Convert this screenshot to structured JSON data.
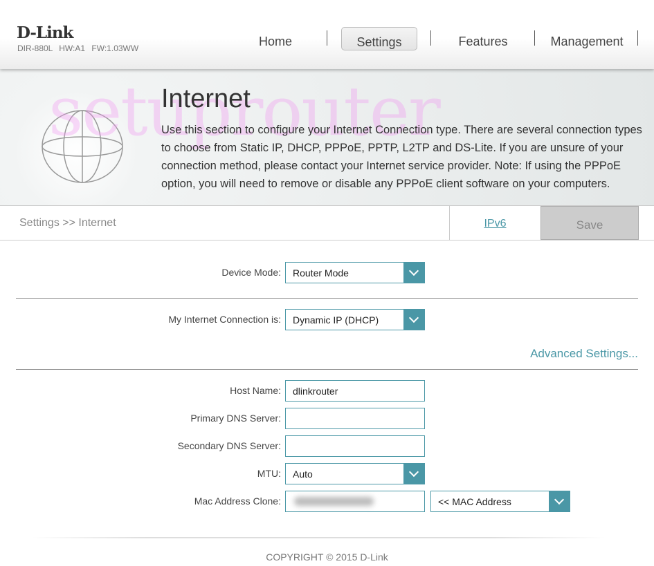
{
  "header": {
    "logo": "D-Link",
    "model": "DIR-880L",
    "hw": "HW:A1",
    "fw": "FW:1.03WW",
    "nav": [
      "Home",
      "Settings",
      "Features",
      "Management"
    ],
    "active": "Settings"
  },
  "banner": {
    "watermark": "setuprouter",
    "title": "Internet",
    "description": "Use this section to configure your Internet Connection type. There are several connection types to choose from Static IP, DHCP, PPPoE, PPTP, L2TP and DS-Lite. If you are unsure of your connection method, please contact your Internet service provider. Note: If using the PPPoE option, you will need to remove or disable any PPPoE client software on your computers."
  },
  "breadcrumb": "Settings >> Internet",
  "ipv6_link": "IPv6",
  "save_label": "Save",
  "form": {
    "device_mode": {
      "label": "Device Mode:",
      "value": "Router Mode"
    },
    "connection": {
      "label": "My Internet Connection is:",
      "value": "Dynamic IP (DHCP)"
    },
    "advanced": "Advanced Settings...",
    "host_name": {
      "label": "Host Name:",
      "value": "dlinkrouter"
    },
    "primary_dns": {
      "label": "Primary DNS Server:",
      "value": ""
    },
    "secondary_dns": {
      "label": "Secondary DNS Server:",
      "value": ""
    },
    "mtu": {
      "label": "MTU:",
      "value": "Auto"
    },
    "mac_clone": {
      "label": "Mac Address Clone:",
      "select": "<< MAC Address"
    }
  },
  "footer": "COPYRIGHT © 2015 D-Link",
  "colors": {
    "accent": "#4a97a6"
  }
}
